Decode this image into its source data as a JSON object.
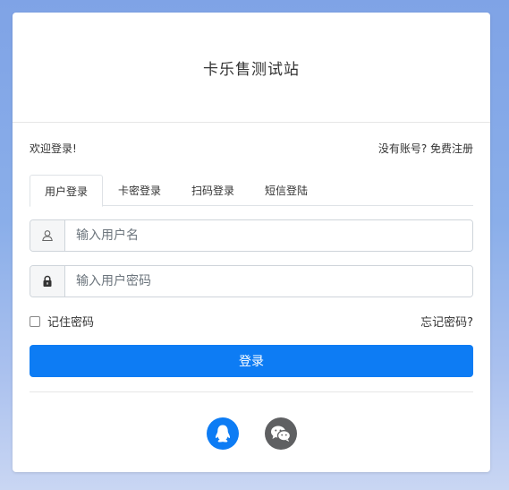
{
  "header": {
    "title": "卡乐售测试站"
  },
  "welcome": {
    "text": "欢迎登录!",
    "register_link": "没有账号? 免费注册"
  },
  "tabs": [
    {
      "label": "用户登录",
      "active": true
    },
    {
      "label": "卡密登录",
      "active": false
    },
    {
      "label": "扫码登录",
      "active": false
    },
    {
      "label": "短信登陆",
      "active": false
    }
  ],
  "form": {
    "username_placeholder": "输入用户名",
    "password_placeholder": "输入用户密码",
    "remember_label": "记住密码",
    "forgot_label": "忘记密码?",
    "submit_label": "登录"
  },
  "social": [
    {
      "name": "qq-icon",
      "color": "#0d7cf4"
    },
    {
      "name": "wechat-icon",
      "color": "#5f6062"
    }
  ],
  "colors": {
    "primary": "#0d7cf4",
    "wechat_gray": "#5f6062"
  }
}
